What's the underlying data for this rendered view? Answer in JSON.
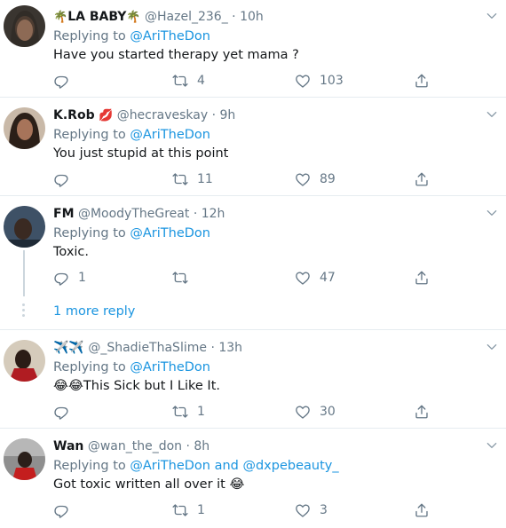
{
  "colors": {
    "link": "#1b95e0",
    "muted": "#657786",
    "text": "#14171a",
    "divider": "#e6ecf0",
    "like_red": "#e0245e"
  },
  "tweets": [
    {
      "name": "LA BABY",
      "name_prefix_emoji": "palm-tree",
      "name_suffix_emoji": "palm-tree",
      "handle": "@Hazel_236_",
      "time": "10h",
      "replying_label": "Replying to",
      "replying_to": "@AriTheDon",
      "text": "Have you started therapy yet mama ?",
      "replies": "",
      "retweets": "4",
      "likes": "103"
    },
    {
      "name": "K.Rob",
      "name_suffix_emoji": "lips",
      "handle": "@hecraveskay",
      "time": "9h",
      "replying_label": "Replying to",
      "replying_to": "@AriTheDon",
      "text": "You just stupid at this point",
      "replies": "",
      "retweets": "11",
      "likes": "89"
    },
    {
      "name": "FM",
      "handle": "@MoodyTheGreat",
      "time": "12h",
      "replying_label": "Replying to",
      "replying_to": "@AriTheDon",
      "text": "Toxic.",
      "replies": "1",
      "retweets": "",
      "likes": "47",
      "more_replies": "1 more reply"
    },
    {
      "name": "✈️✈️",
      "handle": "@_ShadieThaSlime",
      "time": "13h",
      "replying_label": "Replying to",
      "replying_to": "@AriTheDon",
      "text_emoji": "😂😂",
      "text": "This Sick but I Like It.",
      "replies": "",
      "retweets": "1",
      "likes": "30"
    },
    {
      "name": "Wan",
      "handle": "@wan_the_don",
      "time": "8h",
      "replying_label": "Replying to",
      "replying_to": "@AriTheDon",
      "replying_and": "and",
      "replying_to_2": "@dxpebeauty_",
      "text": "Got toxic written all over it",
      "text_emoji": "😂",
      "replies": "",
      "retweets": "1",
      "likes": "3"
    }
  ]
}
